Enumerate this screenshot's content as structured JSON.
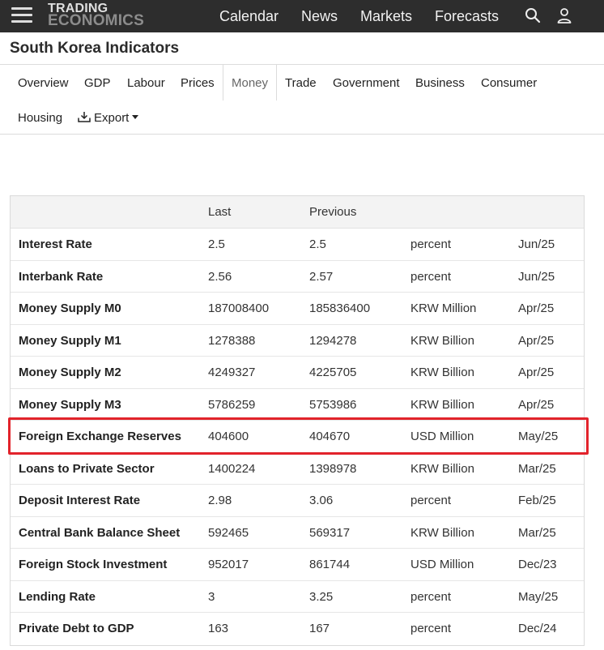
{
  "brand": {
    "line1": "TRADING",
    "line2": "ECONOMICS"
  },
  "nav": {
    "links": [
      "Calendar",
      "News",
      "Markets",
      "Forecasts"
    ]
  },
  "page_title": "South Korea Indicators",
  "tabs": [
    "Overview",
    "GDP",
    "Labour",
    "Prices",
    "Money",
    "Trade",
    "Government",
    "Business",
    "Consumer",
    "Housing"
  ],
  "active_tab": "Money",
  "export_label": "Export",
  "table": {
    "headers": {
      "last": "Last",
      "previous": "Previous"
    },
    "rows": [
      {
        "name": "Interest Rate",
        "last": "2.5",
        "previous": "2.5",
        "unit": "percent",
        "date": "Jun/25"
      },
      {
        "name": "Interbank Rate",
        "last": "2.56",
        "previous": "2.57",
        "unit": "percent",
        "date": "Jun/25"
      },
      {
        "name": "Money Supply M0",
        "last": "187008400",
        "previous": "185836400",
        "unit": "KRW Million",
        "date": "Apr/25"
      },
      {
        "name": "Money Supply M1",
        "last": "1278388",
        "previous": "1294278",
        "unit": "KRW Billion",
        "date": "Apr/25"
      },
      {
        "name": "Money Supply M2",
        "last": "4249327",
        "previous": "4225705",
        "unit": "KRW Billion",
        "date": "Apr/25"
      },
      {
        "name": "Money Supply M3",
        "last": "5786259",
        "previous": "5753986",
        "unit": "KRW Billion",
        "date": "Apr/25"
      },
      {
        "name": "Foreign Exchange Reserves",
        "last": "404600",
        "previous": "404670",
        "unit": "USD Million",
        "date": "May/25"
      },
      {
        "name": "Loans to Private Sector",
        "last": "1400224",
        "previous": "1398978",
        "unit": "KRW Billion",
        "date": "Mar/25"
      },
      {
        "name": "Deposit Interest Rate",
        "last": "2.98",
        "previous": "3.06",
        "unit": "percent",
        "date": "Feb/25"
      },
      {
        "name": "Central Bank Balance Sheet",
        "last": "592465",
        "previous": "569317",
        "unit": "KRW Billion",
        "date": "Mar/25"
      },
      {
        "name": "Foreign Stock Investment",
        "last": "952017",
        "previous": "861744",
        "unit": "USD Million",
        "date": "Dec/23"
      },
      {
        "name": "Lending Rate",
        "last": "3",
        "previous": "3.25",
        "unit": "percent",
        "date": "May/25"
      },
      {
        "name": "Private Debt to GDP",
        "last": "163",
        "previous": "167",
        "unit": "percent",
        "date": "Dec/24"
      }
    ]
  },
  "highlight_color": "#e2232b",
  "icons": {
    "menu": "hamburger-menu-icon",
    "search": "search-icon",
    "user": "user-icon",
    "export": "download-icon"
  }
}
